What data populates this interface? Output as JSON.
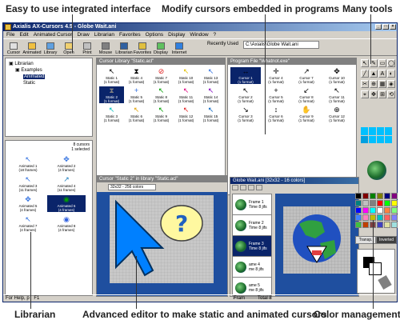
{
  "callouts": {
    "integrated": "Easy to use integrated interface",
    "modify": "Modify cursors embedded in programs",
    "tools": "Many tools",
    "librarian": "Librarian",
    "advanced": "Advanced editor to make static and animated cursors",
    "color": "Color management"
  },
  "window": {
    "title": "Axialis AX-Cursors 4.5 - Globe Wait.ani"
  },
  "menu": [
    "File",
    "Edit",
    "Animated Cursor",
    "Draw",
    "Librarian",
    "Favorites",
    "Options",
    "Display",
    "Window",
    "?"
  ],
  "toolbar": {
    "buttons": [
      "Cursor",
      "Animated",
      "Library",
      "Open",
      "Print",
      "Mouse",
      "Librarian",
      "Favorites",
      "Display",
      "Internet"
    ],
    "recent_label": "Recently Used",
    "recent_value": "C:\\Axialis\\Globe Wait.ani"
  },
  "tree": {
    "root": "Librarian",
    "child": "Examples",
    "items": [
      "Animated",
      "Static"
    ]
  },
  "librarian_count": [
    "8 cursors",
    "1 selected"
  ],
  "librarian_items": [
    {
      "name": "Animated 1",
      "frames": "(18 frames)"
    },
    {
      "name": "Animated 2",
      "frames": "(4 frames)"
    },
    {
      "name": "Animated 3",
      "frames": "(11 frames)"
    },
    {
      "name": "Animated 4",
      "frames": "(11 frames)"
    },
    {
      "name": "Animated 5",
      "frames": "(4 frames)"
    },
    {
      "name": "Animated 6",
      "frames": "(4 frames)"
    },
    {
      "name": "Animated 7",
      "frames": "(4 frames)"
    },
    {
      "name": "Animated 8",
      "frames": "(4 frames)"
    }
  ],
  "cursor_library": {
    "title": "Cursor Library \"Static.acl\"",
    "items": [
      {
        "name": "Static 1",
        "fmt": "(1 format)"
      },
      {
        "name": "Static 4",
        "fmt": "(1 format)"
      },
      {
        "name": "Static 7",
        "fmt": "(1 format)"
      },
      {
        "name": "Static 10",
        "fmt": "(1 format)"
      },
      {
        "name": "Static 13",
        "fmt": "(1 format)"
      },
      {
        "name": "Static 2",
        "fmt": "(1 format)"
      },
      {
        "name": "Static 5",
        "fmt": "(1 format)"
      },
      {
        "name": "Static 8",
        "fmt": "(1 format)"
      },
      {
        "name": "Static 11",
        "fmt": "(1 format)"
      },
      {
        "name": "Static 14",
        "fmt": "(1 format)"
      },
      {
        "name": "Static 3",
        "fmt": "(1 format)"
      },
      {
        "name": "Static 6",
        "fmt": "(1 format)"
      },
      {
        "name": "Static 9",
        "fmt": "(1 format)"
      },
      {
        "name": "Static 12",
        "fmt": "(1 format)"
      },
      {
        "name": "Static 15",
        "fmt": "(1 format)"
      }
    ]
  },
  "program_file": {
    "title": "Program File \"Whatnot.exe\"",
    "items": [
      {
        "name": "Cursor 1",
        "fmt": "(1 format)"
      },
      {
        "name": "Cursor 4",
        "fmt": "(1 format)"
      },
      {
        "name": "Cursor 7",
        "fmt": "(1 format)"
      },
      {
        "name": "Cursor 10",
        "fmt": "(1 format)"
      },
      {
        "name": "Cursor 2",
        "fmt": "(1 format)"
      },
      {
        "name": "Cursor 5",
        "fmt": "(1 format)"
      },
      {
        "name": "Cursor 8",
        "fmt": "(1 format)"
      },
      {
        "name": "Cursor 11",
        "fmt": "(1 format)"
      },
      {
        "name": "Cursor 3",
        "fmt": "(1 format)"
      },
      {
        "name": "Cursor 6",
        "fmt": "(1 format)"
      },
      {
        "name": "Cursor 9",
        "fmt": "(1 format)"
      },
      {
        "name": "Cursor 12",
        "fmt": "(1 format)"
      }
    ]
  },
  "static_editor": {
    "title": "Cursor \"Static 2\" in library \"Static.acl\"",
    "format": "32x32 - 256 colors"
  },
  "globe_editor": {
    "title": "Globe Wait.ani [32x32 - 16 colors]",
    "frames": [
      {
        "name": "Frame 1",
        "time": "Time 8 jifs"
      },
      {
        "name": "Frame 2",
        "time": "Time 8 jifs"
      },
      {
        "name": "Frame 3",
        "time": "Time 8 jifs"
      },
      {
        "name": "ame 4",
        "time": "me 8 jifs"
      },
      {
        "name": "ame 5",
        "time": "me 8 jifs"
      }
    ]
  },
  "color_panel": {
    "transp": "Transp.",
    "inverted": "Inverted"
  },
  "status": {
    "left": "For Help, p",
    "key": "F1",
    "frames": "Fram",
    "total": "Total 8"
  },
  "colors": {
    "accent": "#0a246a",
    "editor_bg": "#1f4f9f",
    "chrome": "#d4d0c8"
  }
}
